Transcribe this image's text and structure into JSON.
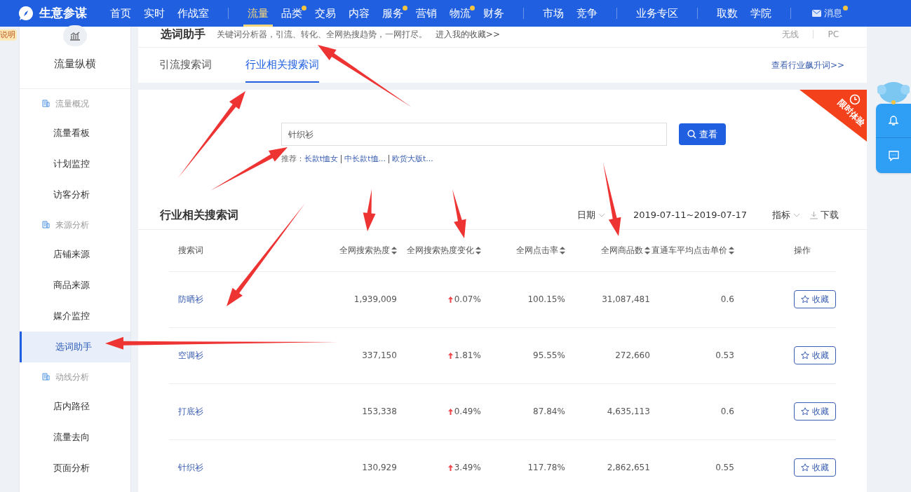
{
  "header": {
    "brand": "生意参谋",
    "nav_groups": [
      [
        {
          "label": "首页",
          "selected": false,
          "dot": false
        },
        {
          "label": "实时",
          "selected": false,
          "dot": false
        },
        {
          "label": "作战室",
          "selected": false,
          "dot": false
        }
      ],
      [
        {
          "label": "流量",
          "selected": true,
          "dot": false
        },
        {
          "label": "品类",
          "selected": false,
          "dot": true
        },
        {
          "label": "交易",
          "selected": false,
          "dot": false
        },
        {
          "label": "内容",
          "selected": false,
          "dot": false
        },
        {
          "label": "服务",
          "selected": false,
          "dot": true
        },
        {
          "label": "营销",
          "selected": false,
          "dot": false
        },
        {
          "label": "物流",
          "selected": false,
          "dot": true
        },
        {
          "label": "财务",
          "selected": false,
          "dot": false
        }
      ],
      [
        {
          "label": "市场",
          "selected": false,
          "dot": false
        },
        {
          "label": "竞争",
          "selected": false,
          "dot": false
        }
      ],
      [
        {
          "label": "业务专区",
          "selected": false,
          "dot": false
        }
      ],
      [
        {
          "label": "取数",
          "selected": false,
          "dot": false
        },
        {
          "label": "学院",
          "selected": false,
          "dot": false
        }
      ]
    ],
    "message": {
      "label": "消息",
      "dot": true
    }
  },
  "help_tag": "说明",
  "sidebar": {
    "title": "流量纵横",
    "sections": [
      {
        "label": "流量概况",
        "items": [
          {
            "label": "流量看板",
            "selected": false
          },
          {
            "label": "计划监控",
            "selected": false
          },
          {
            "label": "访客分析",
            "selected": false
          }
        ]
      },
      {
        "label": "来源分析",
        "items": [
          {
            "label": "店铺来源",
            "selected": false
          },
          {
            "label": "商品来源",
            "selected": false
          },
          {
            "label": "媒介监控",
            "selected": false
          },
          {
            "label": "选词助手",
            "selected": true
          }
        ]
      },
      {
        "label": "动线分析",
        "items": [
          {
            "label": "店内路径",
            "selected": false
          },
          {
            "label": "流量去向",
            "selected": false
          },
          {
            "label": "页面分析",
            "selected": false
          }
        ]
      }
    ]
  },
  "page": {
    "title": "选词助手",
    "subtitle": "关键词分析器，引流、转化、全网热搜趋势，一网打尽。",
    "link": "进入我的收藏>>",
    "platforms": [
      "无线",
      "PC"
    ]
  },
  "tabs": [
    {
      "label": "引流搜索词",
      "selected": false
    },
    {
      "label": "行业相关搜索词",
      "selected": true
    }
  ],
  "tabs_link": "查看行业飙升词>>",
  "ribbon": "限时体验",
  "search": {
    "value": "针织衫",
    "button": "查看",
    "recommend_label": "推荐：",
    "recommendations": [
      "长款t恤女",
      "中长款t恤...",
      "欧货大版t..."
    ]
  },
  "table": {
    "title": "行业相关搜索词",
    "date_label": "日期",
    "date_range": "2019-07-11~2019-07-17",
    "metric_label": "指标",
    "download_label": "下载",
    "columns": [
      "搜索词",
      "全网搜索热度",
      "全网搜索热度变化",
      "全网点击率",
      "全网商品数",
      "直通车平均点击单价",
      "操作"
    ],
    "rows": [
      {
        "keyword": "防晒衫",
        "heat": "1,939,009",
        "change": "0.07%",
        "ctr": "100.15%",
        "products": "31,087,481",
        "cpc": "0.6",
        "action": "收藏"
      },
      {
        "keyword": "空调衫",
        "heat": "337,150",
        "change": "1.81%",
        "ctr": "95.55%",
        "products": "272,660",
        "cpc": "0.53",
        "action": "收藏"
      },
      {
        "keyword": "打底衫",
        "heat": "153,338",
        "change": "0.49%",
        "ctr": "87.84%",
        "products": "4,635,113",
        "cpc": "0.6",
        "action": "收藏"
      },
      {
        "keyword": "针织衫",
        "heat": "130,929",
        "change": "3.49%",
        "ctr": "117.78%",
        "products": "2,862,651",
        "cpc": "0.55",
        "action": "收藏"
      }
    ]
  }
}
